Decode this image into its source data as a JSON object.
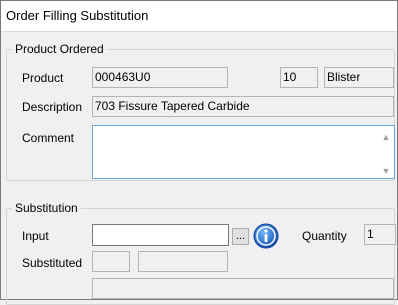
{
  "window": {
    "title": "Order Filling Substitution"
  },
  "product_ordered": {
    "caption": "Product Ordered",
    "product_label": "Product",
    "product_code": "000463U0",
    "quantity": "10",
    "unit": "Blister",
    "description_label": "Description",
    "description": "703 Fissure Tapered Carbide",
    "comment_label": "Comment",
    "comment_value": ""
  },
  "substitution": {
    "caption": "Substitution",
    "input_label": "Input",
    "input_value": "",
    "browse_label": "...",
    "quantity_label": "Quantity",
    "quantity_value": "1",
    "substituted_label": "Substituted",
    "substituted_code": "",
    "substituted_name": "",
    "substituted_description": ""
  },
  "icons": {
    "info": "info-icon",
    "scroll_up": "chevron-up-icon",
    "scroll_down": "chevron-down-icon"
  },
  "colors": {
    "info_icon": "#1e6fd0",
    "comment_border": "#6fa8dc"
  }
}
